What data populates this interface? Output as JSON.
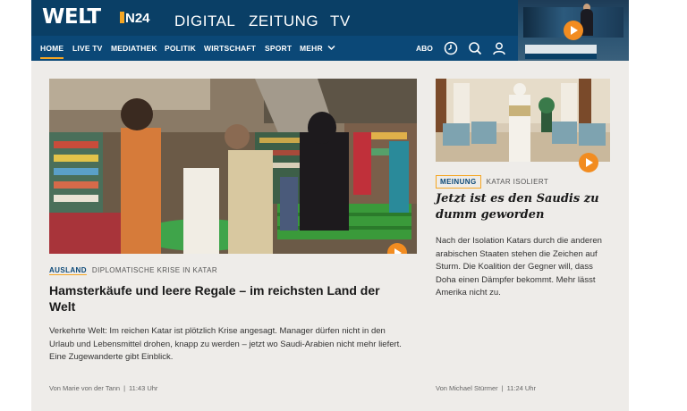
{
  "header": {
    "logo": "WELT",
    "n24_label": "N24",
    "sections": [
      "DIGITAL",
      "ZEITUNG",
      "TV"
    ],
    "nav": [
      "HOME",
      "LIVE TV",
      "MEDIATHEK",
      "POLITIK",
      "WIRTSCHAFT",
      "SPORT",
      "MEHR"
    ],
    "abo_label": "ABO",
    "brand_color": "#0a3f66",
    "accent_color": "#f5a623"
  },
  "main_article": {
    "tag": "AUSLAND",
    "kicker": "DIPLOMATISCHE KRISE IN KATAR",
    "title": "Hamsterkäufe und leere Regale – im reichsten Land der Welt",
    "teaser": "Verkehrte Welt: Im reichen Katar ist plötzlich Krise angesagt. Manager dürfen nicht in den Urlaub und Lebensmittel drohen, knapp zu werden – jetzt wo Saudi-Arabien nicht mehr liefert. Eine Zugewanderte gibt Einblick.",
    "byline": "Von Marie von der Tann",
    "time": "11:43 Uhr"
  },
  "side_article": {
    "tag": "MEINUNG",
    "kicker": "KATAR ISOLIERT",
    "title": "Jetzt ist es den Saudis zu dumm geworden",
    "teaser": "Nach der Isolation Katars durch die anderen arabischen Staaten stehen die Zeichen auf Sturm. Die Koalition der Gegner will, dass Doha einen Dämpfer bekommt. Mehr lässt Amerika nicht zu.",
    "byline": "Von Michael Stürmer",
    "time": "11:24 Uhr"
  }
}
